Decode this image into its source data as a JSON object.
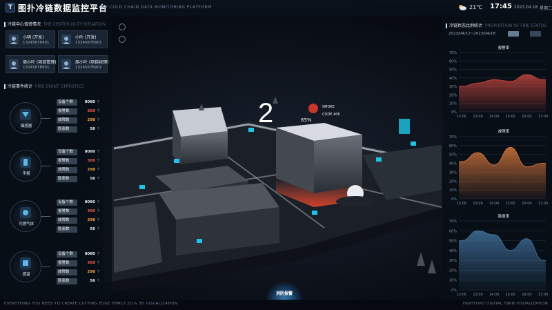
{
  "header": {
    "logo_letter": "T",
    "title": "图扑冷链数据监控平台",
    "subtitle": "TP COLD CHAIN DATA MONITORING PLATFORM",
    "temperature": "21℃",
    "time": "17:45",
    "date": "2023.04.18",
    "weekday": "星期二"
  },
  "left": {
    "duty_title": "冷链中心值班情况",
    "duty_title_en": "THE CENTER DUTY SITUATION",
    "people": [
      {
        "name": "小明  (开发)",
        "phone": "13245678901"
      },
      {
        "name": "小叶  (开发)",
        "phone": "13245678901"
      },
      {
        "name": "周小叶  (项目管理)",
        "phone": "13245678901"
      },
      {
        "name": "周小叶  (项目经理)",
        "phone": "13245678901"
      }
    ],
    "event_title": "冷链事件统计",
    "event_title_en": "FIRE EVENT STATISTICS",
    "categories": [
      {
        "label": "烟感器",
        "stats": [
          {
            "key": "设备个数",
            "value": "8080",
            "unit": "个"
          },
          {
            "key": "报警数",
            "value": "300",
            "unit": "个"
          },
          {
            "key": "故障数",
            "value": "298",
            "unit": "个"
          },
          {
            "key": "隐患数",
            "value": "56",
            "unit": "个"
          }
        ]
      },
      {
        "label": "手报",
        "stats": [
          {
            "key": "设备个数",
            "value": "8080",
            "unit": "个"
          },
          {
            "key": "报警数",
            "value": "300",
            "unit": "个"
          },
          {
            "key": "故障数",
            "value": "298",
            "unit": "个"
          },
          {
            "key": "隐患数",
            "value": "56",
            "unit": "个"
          }
        ]
      },
      {
        "label": "可燃气体",
        "stats": [
          {
            "key": "设备个数",
            "value": "8080",
            "unit": "个"
          },
          {
            "key": "报警数",
            "value": "300",
            "unit": "个"
          },
          {
            "key": "故障数",
            "value": "298",
            "unit": "个"
          },
          {
            "key": "隐患数",
            "value": "56",
            "unit": "个"
          }
        ]
      },
      {
        "label": "感温",
        "stats": [
          {
            "key": "设备个数",
            "value": "8080",
            "unit": "个"
          },
          {
            "key": "报警数",
            "value": "300",
            "unit": "个"
          },
          {
            "key": "故障数",
            "value": "298",
            "unit": "个"
          },
          {
            "key": "隐患数",
            "value": "56",
            "unit": "个"
          }
        ]
      }
    ]
  },
  "right": {
    "title": "冷链状态比例统计",
    "title_en": "PROPORTION OF FIRE STATUS",
    "date_range": "2023/04/12~2023/04/18",
    "charts": [
      {
        "title": "报警率",
        "color": "#b3413a"
      },
      {
        "title": "故障率",
        "color": "#c8703a"
      },
      {
        "title": "隐患率",
        "color": "#3e6a94"
      }
    ]
  },
  "scene": {
    "big_number": "2",
    "percent": "65%",
    "alarm_line1": "SMOKE",
    "alarm_line2": "CODE 406",
    "bottom_button": "消防报警"
  },
  "footer": {
    "left": "EVERYTHING YOU NEED TO CREATE CUTTING EDGE HTML5 2D & 3D VISUALIZATION",
    "right": "HIGHTOPO DIGITAL TWIN VISUALIZATION"
  },
  "colors": {
    "alarm": "#f05a4a",
    "fault": "#f3a23b",
    "normal": "#e6eef7",
    "panel_bg": "#080e16"
  },
  "chart_data": [
    {
      "type": "area",
      "title": "报警率",
      "x": [
        "12:00",
        "13:00",
        "14:00",
        "15:00",
        "16:00",
        "17:00"
      ],
      "series": [
        {
          "values": [
            30,
            34,
            38,
            36,
            44,
            38
          ]
        }
      ],
      "y_ticks": [
        "0%",
        "10%",
        "20%",
        "30%",
        "40%",
        "50%",
        "60%",
        "70%"
      ],
      "ylim": [
        0,
        70
      ]
    },
    {
      "type": "area",
      "title": "故障率",
      "x": [
        "12:00",
        "13:00",
        "14:00",
        "15:00",
        "16:00",
        "17:00"
      ],
      "series": [
        {
          "values": [
            42,
            52,
            38,
            58,
            36,
            40
          ]
        }
      ],
      "y_ticks": [
        "0%",
        "10%",
        "20%",
        "30%",
        "40%",
        "50%",
        "60%",
        "70%"
      ],
      "ylim": [
        0,
        70
      ]
    },
    {
      "type": "area",
      "title": "隐患率",
      "x": [
        "12:00",
        "13:00",
        "14:00",
        "15:00",
        "16:00",
        "17:00"
      ],
      "series": [
        {
          "values": [
            50,
            60,
            56,
            40,
            52,
            30
          ]
        }
      ],
      "y_ticks": [
        "0%",
        "10%",
        "20%",
        "30%",
        "40%",
        "50%",
        "60%",
        "70%"
      ],
      "ylim": [
        0,
        70
      ]
    }
  ]
}
